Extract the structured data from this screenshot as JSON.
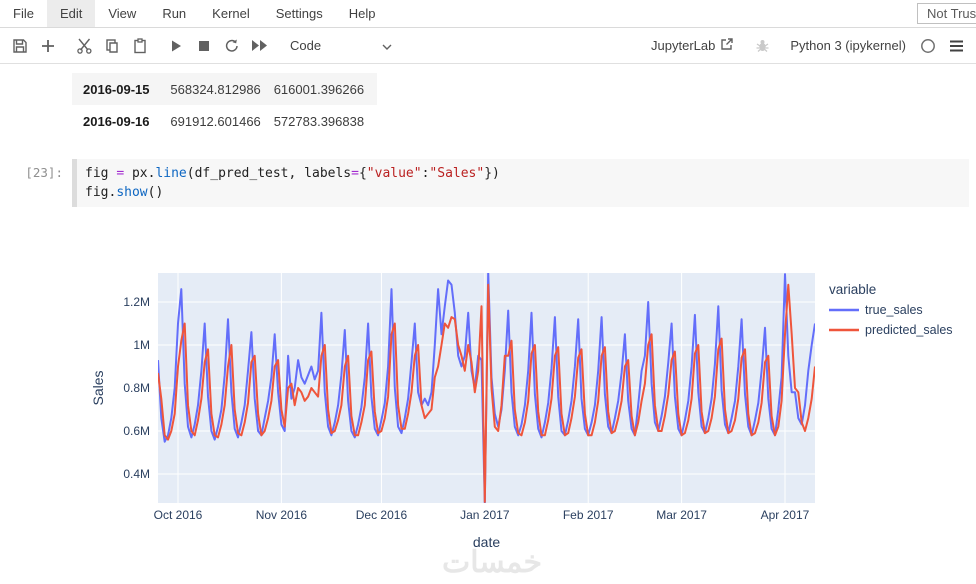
{
  "menu": {
    "items": [
      {
        "label": "File"
      },
      {
        "label": "Edit"
      },
      {
        "label": "View"
      },
      {
        "label": "Run"
      },
      {
        "label": "Kernel"
      },
      {
        "label": "Settings"
      },
      {
        "label": "Help"
      }
    ],
    "active_item": "Edit",
    "trust_label": "Not Trus"
  },
  "toolbar": {
    "cell_type": "Code",
    "jupyterlab_label": "JupyterLab",
    "kernel_name": "Python 3 (ipykernel)",
    "icon_names": [
      "save-icon",
      "add-cell-icon",
      "cut-icon",
      "copy-icon",
      "paste-icon",
      "run-icon",
      "stop-icon",
      "restart-kernel-icon",
      "run-all-icon",
      "chevron-down-icon",
      "external-link-icon",
      "debugger-bug-icon",
      "kernel-status-circle-icon",
      "hamburger-menu-icon"
    ]
  },
  "output_table": {
    "rows": [
      [
        "2016-09-15",
        "568324.812986",
        "616001.396266"
      ],
      [
        "2016-09-16",
        "691912.601466",
        "572783.396838"
      ]
    ]
  },
  "code_cell": {
    "prompt": "[23]:",
    "lines": [
      [
        [
          "fig",
          "v"
        ],
        [
          " ",
          "t"
        ],
        [
          "=",
          "o"
        ],
        [
          " ",
          "t"
        ],
        [
          "px",
          "v"
        ],
        [
          ".",
          "t"
        ],
        [
          "line",
          "f"
        ],
        [
          "(",
          "t"
        ],
        [
          "df_pred_test",
          "v"
        ],
        [
          ",",
          "t"
        ],
        [
          " ",
          "t"
        ],
        [
          "labels",
          "v"
        ],
        [
          "=",
          "o"
        ],
        [
          "{",
          "t"
        ],
        [
          "\"value\"",
          "s"
        ],
        [
          ":",
          "t"
        ],
        [
          "\"Sales\"",
          "s"
        ],
        [
          "}",
          "t"
        ],
        [
          ")",
          "t"
        ]
      ],
      [
        [
          "fig",
          "v"
        ],
        [
          ".",
          "t"
        ],
        [
          "show",
          "f"
        ],
        [
          "(",
          "t"
        ],
        [
          ")",
          "t"
        ]
      ]
    ]
  },
  "chart_data": {
    "type": "line",
    "xlabel": "date",
    "ylabel": "Sales",
    "legend_title": "variable",
    "legend_position": "right-top",
    "grid": true,
    "plot_bg": "#E5ECF6",
    "grid_color": "#ffffff",
    "text_color": "#2a3f5f",
    "unit": "millions",
    "ylim_m": [
      0.265,
      1.335
    ],
    "y_ticks": [
      {
        "label": "0.4M",
        "value": 0.4
      },
      {
        "label": "0.6M",
        "value": 0.6
      },
      {
        "label": "0.8M",
        "value": 0.8
      },
      {
        "label": "1M",
        "value": 1.0
      },
      {
        "label": "1.2M",
        "value": 1.2
      }
    ],
    "x_start_date": "2016-09-25",
    "x_ticks": [
      {
        "label": "Oct 2016",
        "day_index": 6
      },
      {
        "label": "Nov 2016",
        "day_index": 37
      },
      {
        "label": "Dec 2016",
        "day_index": 67
      },
      {
        "label": "Jan 2017",
        "day_index": 98
      },
      {
        "label": "Feb 2017",
        "day_index": 129
      },
      {
        "label": "Mar 2017",
        "day_index": 157
      },
      {
        "label": "Apr 2017",
        "day_index": 188
      }
    ],
    "series": [
      {
        "name": "true_sales",
        "color": "#636EFA",
        "values_m": [
          0.93,
          0.66,
          0.55,
          0.58,
          0.66,
          0.8,
          1.1,
          1.26,
          0.82,
          0.62,
          0.57,
          0.63,
          0.72,
          0.88,
          1.1,
          0.76,
          0.6,
          0.56,
          0.62,
          0.7,
          0.86,
          1.12,
          0.78,
          0.61,
          0.57,
          0.64,
          0.72,
          0.88,
          1.06,
          0.75,
          0.6,
          0.58,
          0.66,
          0.74,
          0.85,
          1.05,
          0.78,
          0.63,
          0.6,
          0.95,
          0.75,
          0.8,
          0.93,
          0.85,
          0.82,
          0.86,
          0.9,
          0.84,
          0.88,
          1.15,
          0.78,
          0.62,
          0.58,
          0.64,
          0.72,
          0.86,
          1.07,
          0.74,
          0.6,
          0.57,
          0.63,
          0.71,
          0.85,
          1.1,
          0.76,
          0.61,
          0.58,
          0.65,
          0.73,
          0.9,
          1.26,
          0.8,
          0.62,
          0.59,
          0.66,
          0.75,
          0.92,
          1.1,
          0.78,
          0.72,
          0.75,
          0.72,
          0.78,
          1.0,
          1.26,
          1.05,
          1.18,
          1.3,
          1.28,
          1.15,
          0.95,
          0.9,
          0.95,
          1.15,
          0.88,
          0.8,
          0.95,
          0.93,
          0.26,
          1.34,
          0.85,
          0.68,
          0.62,
          0.7,
          0.88,
          1.16,
          0.78,
          0.62,
          0.58,
          0.63,
          0.72,
          0.88,
          1.15,
          0.77,
          0.61,
          0.57,
          0.64,
          0.73,
          0.89,
          1.13,
          0.76,
          0.6,
          0.58,
          0.65,
          0.74,
          0.9,
          1.12,
          0.75,
          0.61,
          0.58,
          0.64,
          0.72,
          0.88,
          1.13,
          0.77,
          0.62,
          0.59,
          0.66,
          0.74,
          0.87,
          1.05,
          0.74,
          0.61,
          0.58,
          0.72,
          0.88,
          0.95,
          1.2,
          0.82,
          0.64,
          0.6,
          0.67,
          0.76,
          0.92,
          1.1,
          0.76,
          0.61,
          0.58,
          0.65,
          0.74,
          0.9,
          1.14,
          0.78,
          0.62,
          0.59,
          0.66,
          0.75,
          0.91,
          1.18,
          0.79,
          0.63,
          0.59,
          0.66,
          0.74,
          0.9,
          1.12,
          0.77,
          0.62,
          0.58,
          0.65,
          0.73,
          0.88,
          1.08,
          0.75,
          0.61,
          0.58,
          0.7,
          0.85,
          1.33,
          0.95,
          0.78,
          0.78,
          0.66,
          0.63,
          0.72,
          0.88,
          1.0,
          1.1
        ]
      },
      {
        "name": "predicted_sales",
        "color": "#EF553B",
        "values_m": [
          0.87,
          0.75,
          0.58,
          0.56,
          0.6,
          0.68,
          0.9,
          1.02,
          1.1,
          0.72,
          0.6,
          0.58,
          0.65,
          0.75,
          0.92,
          0.98,
          0.68,
          0.58,
          0.57,
          0.63,
          0.72,
          0.9,
          1.0,
          0.7,
          0.59,
          0.58,
          0.64,
          0.73,
          0.92,
          0.95,
          0.68,
          0.58,
          0.6,
          0.66,
          0.74,
          0.9,
          0.93,
          0.7,
          0.62,
          0.8,
          0.82,
          0.72,
          0.8,
          0.78,
          0.74,
          0.76,
          0.8,
          0.78,
          0.76,
          0.95,
          1.0,
          0.7,
          0.59,
          0.6,
          0.65,
          0.72,
          0.9,
          0.95,
          0.67,
          0.58,
          0.58,
          0.64,
          0.72,
          0.93,
          0.97,
          0.69,
          0.59,
          0.6,
          0.66,
          0.76,
          1.05,
          1.1,
          0.72,
          0.61,
          0.61,
          0.68,
          0.78,
          0.95,
          1.0,
          0.72,
          0.66,
          0.68,
          0.7,
          0.85,
          0.9,
          1.0,
          1.1,
          1.08,
          1.13,
          1.12,
          1.0,
          0.95,
          0.88,
          1.0,
          0.92,
          0.78,
          0.88,
          1.18,
          0.27,
          1.28,
          0.8,
          0.62,
          0.6,
          0.72,
          0.95,
          0.95,
          1.02,
          0.7,
          0.59,
          0.58,
          0.64,
          0.74,
          0.96,
          1.0,
          0.69,
          0.58,
          0.58,
          0.65,
          0.75,
          0.95,
          0.99,
          0.68,
          0.58,
          0.59,
          0.66,
          0.76,
          0.94,
          0.98,
          0.68,
          0.58,
          0.58,
          0.64,
          0.74,
          0.95,
          0.99,
          0.69,
          0.59,
          0.6,
          0.66,
          0.74,
          0.9,
          0.93,
          0.67,
          0.58,
          0.64,
          0.74,
          0.82,
          1.0,
          1.05,
          0.72,
          0.6,
          0.6,
          0.67,
          0.77,
          0.93,
          0.97,
          0.68,
          0.58,
          0.59,
          0.65,
          0.75,
          0.96,
          1.0,
          0.69,
          0.59,
          0.6,
          0.66,
          0.76,
          0.98,
          1.03,
          0.7,
          0.59,
          0.6,
          0.65,
          0.75,
          0.94,
          0.98,
          0.68,
          0.58,
          0.59,
          0.64,
          0.73,
          0.92,
          0.95,
          0.67,
          0.58,
          0.62,
          0.74,
          1.05,
          1.28,
          1.05,
          0.8,
          0.78,
          0.64,
          0.6,
          0.66,
          0.75,
          0.9
        ]
      }
    ]
  },
  "watermark": "خمسات"
}
